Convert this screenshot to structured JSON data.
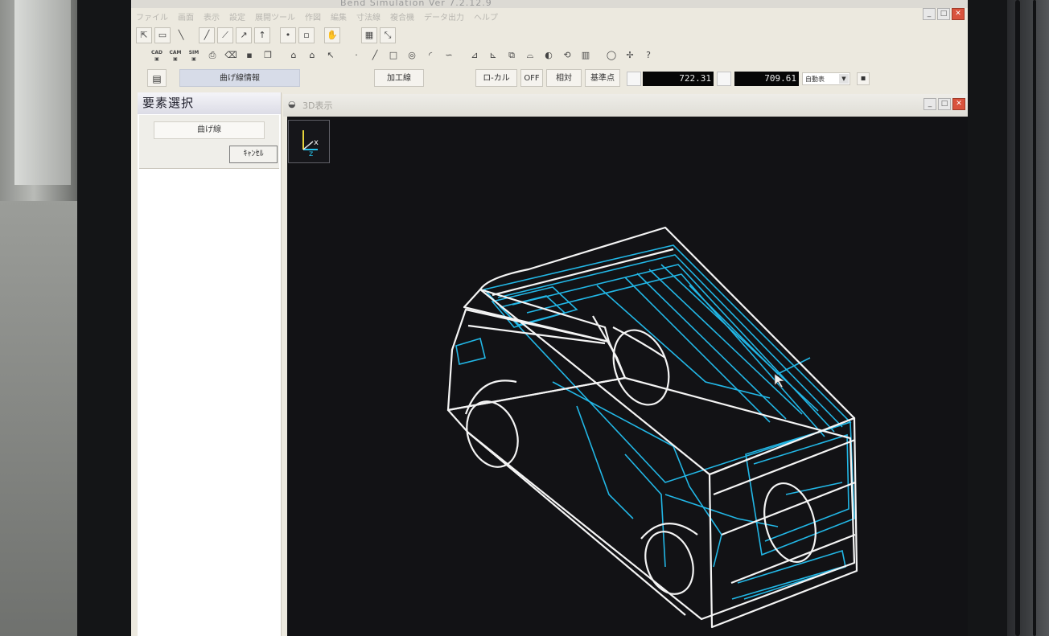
{
  "window": {
    "title": "Bend Simulation Ver 7.2.12.9",
    "min_glyph": "_",
    "max_glyph": "□",
    "close_glyph": "✕"
  },
  "menu": [
    "ファイル",
    "画面",
    "表示",
    "設定",
    "展開ツール",
    "作図",
    "編集",
    "寸法線",
    "複合機",
    "データ出力",
    "ヘルプ"
  ],
  "cmdbar": {
    "mode_label": "曲げ線情報",
    "process_button": "加工線",
    "buttons": [
      "ロ-カル",
      "OFF",
      "相対",
      "基準点"
    ],
    "coord_x": "722.31",
    "coord_y": "709.61",
    "unit_select": "自動表"
  },
  "panel": {
    "title": "要素選択",
    "bend_line_button": "曲げ線",
    "cancel_button": "ｷｬﾝｾﾙ"
  },
  "view": {
    "title": "3D表示",
    "axis_x": "x",
    "axis_z": "z"
  },
  "colors": {
    "wireframe": "#f4f4f4",
    "detail": "#22b7e6",
    "viewport_bg": "#121215"
  }
}
